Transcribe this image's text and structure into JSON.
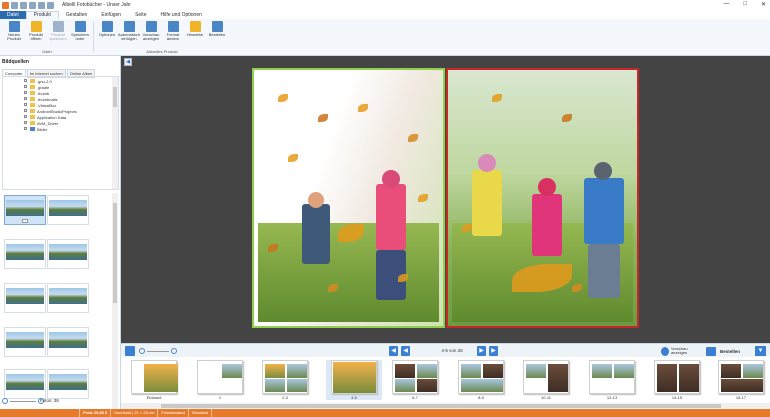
{
  "window": {
    "title": "Albelli Fotobücher - Unser Jahr",
    "buttons": {
      "minimize": "—",
      "maximize": "□",
      "close": "✕"
    }
  },
  "menu": {
    "tabs": [
      {
        "label": "Datei"
      },
      {
        "label": "Produkt"
      },
      {
        "label": "Gestalten"
      },
      {
        "label": "Einfügen"
      },
      {
        "label": "Seite"
      },
      {
        "label": "Hilfe und Optionen"
      }
    ]
  },
  "ribbon": {
    "groups": [
      {
        "label": "Datei",
        "buttons": [
          {
            "label": "Neues Produkt",
            "icon": "new-product-icon",
            "color": "#4a86c5"
          },
          {
            "label": "Produkt öffnen",
            "icon": "open-folder-icon",
            "color": "#f0b429"
          },
          {
            "label": "Produkt speichern",
            "icon": "save-icon",
            "color": "#9fb4c9"
          },
          {
            "label": "Speichern unter",
            "icon": "save-as-icon",
            "color": "#4a86c5"
          }
        ]
      },
      {
        "label": "Aktuelles Produkt",
        "buttons": [
          {
            "label": "Optionen",
            "icon": "options-icon",
            "color": "#4a86c5"
          },
          {
            "label": "Automatisch einfügen",
            "icon": "auto-insert-icon",
            "color": "#4a86c5"
          },
          {
            "label": "Vorschau anzeigen",
            "icon": "preview-icon",
            "color": "#4a86c5"
          },
          {
            "label": "Format ändern",
            "icon": "format-icon",
            "color": "#4a86c5"
          },
          {
            "label": "Hinweise",
            "icon": "warning-icon",
            "color": "#f0b429"
          },
          {
            "label": "Bestellen",
            "icon": "cart-icon",
            "color": "#4a86c5"
          }
        ]
      }
    ]
  },
  "sidebar": {
    "header": "Bildquellen",
    "tabs": [
      {
        "label": "Computer"
      },
      {
        "label": "Im Internet suchen"
      },
      {
        "label": "Online Alben"
      }
    ],
    "tree": [
      {
        "label": ".gnu-2.0"
      },
      {
        "label": ".gradle"
      },
      {
        "label": ".thumb"
      },
      {
        "label": ".thumbnails"
      },
      {
        "label": ".VirtualBox"
      },
      {
        "label": "AndroidStudioProjects"
      },
      {
        "label": "Application Data"
      },
      {
        "label": "AVM_Driver"
      },
      {
        "label": "Bilder"
      }
    ],
    "fotos_count": "Fotos: 38"
  },
  "editor": {
    "collapse_label": "◀"
  },
  "strip": {
    "page_count": "4-5 von 28",
    "nav": {
      "first": "◀",
      "prev": "◀",
      "next": "▶",
      "last": "▶"
    },
    "vorschau_label": "Vorschau anzeigen",
    "bestellen_label": "Bestellen",
    "expand_label": "▼",
    "spreads": [
      {
        "label": "Einband"
      },
      {
        "label": "1"
      },
      {
        "label": "2-3"
      },
      {
        "label": "4-5"
      },
      {
        "label": "6-7"
      },
      {
        "label": "8-9"
      },
      {
        "label": "10-11"
      },
      {
        "label": "12-13"
      },
      {
        "label": "14-15"
      },
      {
        "label": "16-17"
      }
    ]
  },
  "status": {
    "segments": [
      {
        "label": "Preis 29,65 €"
      },
      {
        "label": "Hochkant | 21 × 28 cm"
      },
      {
        "label": "Fotostandard"
      },
      {
        "label": "Standard"
      }
    ]
  },
  "colors": {
    "accent": "#2b6cb0",
    "status_bar": "#e57a2a",
    "canvas_bg": "#444444",
    "left_page_border": "#8fd14f",
    "right_page_border": "#c62828"
  }
}
